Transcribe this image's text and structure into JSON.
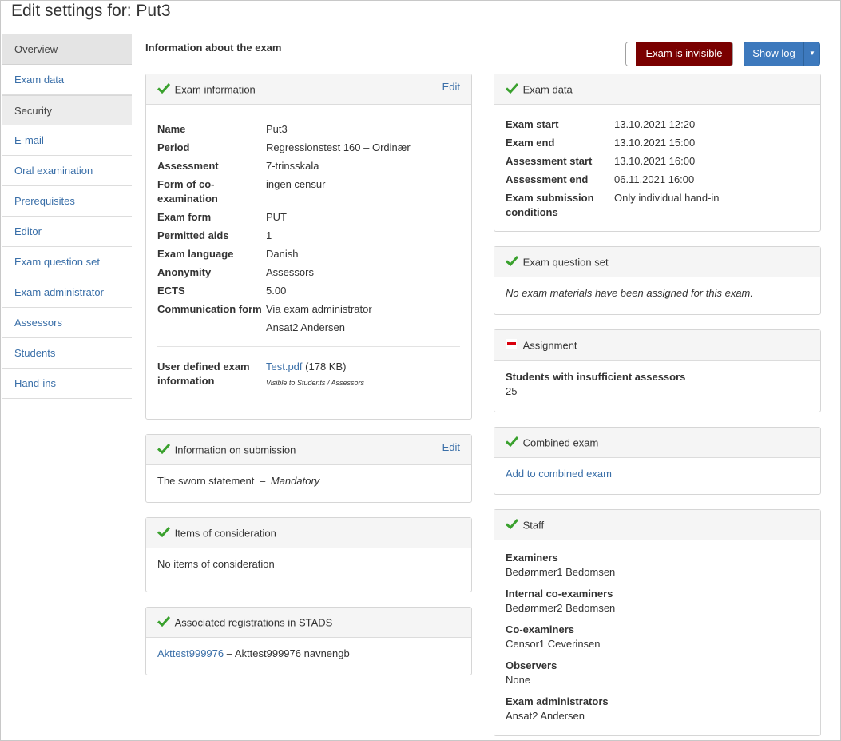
{
  "page": {
    "title": "Edit settings for: Put3"
  },
  "sidebar": {
    "items": [
      {
        "label": "Overview"
      },
      {
        "label": "Exam data"
      },
      {
        "label": "Security"
      },
      {
        "label": "E-mail"
      },
      {
        "label": "Oral examination"
      },
      {
        "label": "Prerequisites"
      },
      {
        "label": "Editor"
      },
      {
        "label": "Exam question set"
      },
      {
        "label": "Exam administrator"
      },
      {
        "label": "Assessors"
      },
      {
        "label": "Students"
      },
      {
        "label": "Hand-ins"
      }
    ]
  },
  "main": {
    "heading": "Information about the exam"
  },
  "toolbar": {
    "invisible_label": "Exam is invisible",
    "show_log_label": "Show log",
    "invisible_color": "#7a0000",
    "show_log_color": "#3d79bd"
  },
  "exam_info": {
    "title": "Exam information",
    "edit_label": "Edit",
    "rows": [
      {
        "k": "Name",
        "v": "Put3"
      },
      {
        "k": "Period",
        "v": "Regressionstest 160  –  Ordinær"
      },
      {
        "k": "Assessment",
        "v": "7-trinsskala"
      },
      {
        "k": "Form of co-examination",
        "v": "ingen censur"
      },
      {
        "k": "Exam form",
        "v": "PUT"
      },
      {
        "k": "Permitted aids",
        "v": "1"
      },
      {
        "k": "Exam language",
        "v": "Danish"
      },
      {
        "k": "Anonymity",
        "v": "Assessors"
      },
      {
        "k": "ECTS",
        "v": "5.00"
      },
      {
        "k": "Communication form",
        "v": "Via exam administrator"
      }
    ],
    "extra_value": "Ansat2 Andersen",
    "user_defined_label": "User defined exam information",
    "file_link": "Test.pdf",
    "file_size": "(178 KB)",
    "visibility_note": "Visible to Students / Assessors"
  },
  "submission": {
    "title": "Information on submission",
    "edit_label": "Edit",
    "statement": "The sworn statement",
    "dash": "–",
    "status": "Mandatory"
  },
  "consideration": {
    "title": "Items of consideration",
    "text": "No items of consideration"
  },
  "stads": {
    "title": "Associated registrations in STADS",
    "link": "Akttest999976",
    "text": "– Akttest999976 navnengb"
  },
  "exam_data": {
    "title": "Exam data",
    "rows": [
      {
        "k": "Exam start",
        "v": "13.10.2021 12:20"
      },
      {
        "k": "Exam end",
        "v": "13.10.2021 15:00"
      },
      {
        "k": "Assessment start",
        "v": "13.10.2021 16:00"
      },
      {
        "k": "Assessment end",
        "v": "06.11.2021 16:00"
      },
      {
        "k": "Exam submission conditions",
        "v": "Only individual hand-in"
      }
    ]
  },
  "question_set": {
    "title": "Exam question set",
    "text": "No exam materials have been assigned for this exam."
  },
  "assignment": {
    "title": "Assignment",
    "label": "Students with insufficient assessors",
    "value": "25"
  },
  "combined": {
    "title": "Combined exam",
    "link": "Add to combined exam"
  },
  "staff": {
    "title": "Staff",
    "groups": [
      {
        "label": "Examiners",
        "value": "Bedømmer1 Bedomsen"
      },
      {
        "label": "Internal co-examiners",
        "value": "Bedømmer2 Bedomsen"
      },
      {
        "label": "Co-examiners",
        "value": "Censor1 Ceverinsen"
      },
      {
        "label": "Observers",
        "value": "None"
      },
      {
        "label": "Exam administrators",
        "value": "Ansat2 Andersen"
      }
    ]
  },
  "icons": {
    "ok": "check-icon",
    "warn": "minus-icon",
    "check_color": "#3aa12e",
    "warn_color": "#d9000d"
  }
}
